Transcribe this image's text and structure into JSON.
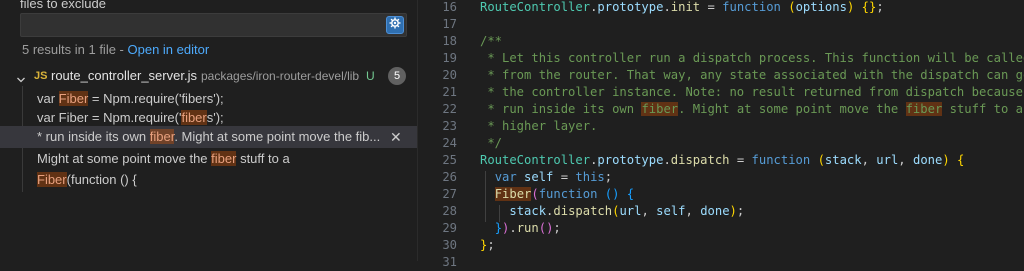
{
  "search": {
    "exclude_label": "files to exclude",
    "exclude_value": "",
    "results_summary": "5 results in 1 file - ",
    "open_in_editor": "Open in editor",
    "file": {
      "type_badge": "JS",
      "name": "route_controller_server.js",
      "path": "packages/iron-router-devel/lib",
      "git_status": "U",
      "match_count": "5"
    },
    "matches": [
      {
        "pre": "var ",
        "hit": "Fiber",
        "post": " = Npm.require('fibers');"
      },
      {
        "pre": "var Fiber = Npm.require('",
        "hit": "fiber",
        "post": "s');"
      },
      {
        "pre": "* run inside its own ",
        "hit": "fiber",
        "post": ". Might at some point move the fib..."
      },
      {
        "pre": "Might at some point move the ",
        "hit": "fiber",
        "post": " stuff to a"
      },
      {
        "pre": "",
        "hit": "Fiber",
        "post": "(function () {"
      }
    ],
    "dismiss_glyph": "✕"
  },
  "editor": {
    "lines": [
      {
        "n": "16",
        "parts": [
          {
            "t": "RouteController",
            "c": "cls"
          },
          {
            "t": ".",
            "c": "punc"
          },
          {
            "t": "prototype",
            "c": "vr"
          },
          {
            "t": ".",
            "c": "punc"
          },
          {
            "t": "init",
            "c": "fn"
          },
          {
            "t": " = ",
            "c": "punc"
          },
          {
            "t": "function",
            "c": "kw"
          },
          {
            "t": " ",
            "c": "punc"
          },
          {
            "t": "(",
            "c": "brk"
          },
          {
            "t": "options",
            "c": "vr"
          },
          {
            "t": ")",
            "c": "brk"
          },
          {
            "t": " ",
            "c": "punc"
          },
          {
            "t": "{}",
            "c": "brk"
          },
          {
            "t": ";",
            "c": "punc"
          }
        ]
      },
      {
        "n": "17",
        "parts": []
      },
      {
        "n": "18",
        "parts": [
          {
            "t": "/**",
            "c": "cmt"
          }
        ]
      },
      {
        "n": "19",
        "parts": [
          {
            "t": " * Let this controller run a dispatch process. This function will be called",
            "c": "cmt"
          }
        ]
      },
      {
        "n": "20",
        "parts": [
          {
            "t": " * from the router. That way, any state associated with the dispatch can go on",
            "c": "cmt"
          }
        ]
      },
      {
        "n": "21",
        "parts": [
          {
            "t": " * the controller instance. Note: no result returned from dispatch because its",
            "c": "cmt"
          }
        ]
      },
      {
        "n": "22",
        "parts": [
          {
            "t": " * run inside its own ",
            "c": "cmt"
          },
          {
            "t": "fiber",
            "c": "cmt hlc"
          },
          {
            "t": ". Might at some point move the ",
            "c": "cmt"
          },
          {
            "t": "fiber",
            "c": "cmt hlc"
          },
          {
            "t": " stuff to a",
            "c": "cmt"
          }
        ]
      },
      {
        "n": "23",
        "parts": [
          {
            "t": " * higher layer.",
            "c": "cmt"
          }
        ]
      },
      {
        "n": "24",
        "parts": [
          {
            "t": " */",
            "c": "cmt"
          }
        ]
      },
      {
        "n": "25",
        "parts": [
          {
            "t": "RouteController",
            "c": "cls"
          },
          {
            "t": ".",
            "c": "punc"
          },
          {
            "t": "prototype",
            "c": "vr"
          },
          {
            "t": ".",
            "c": "punc"
          },
          {
            "t": "dispatch",
            "c": "fn"
          },
          {
            "t": " = ",
            "c": "punc"
          },
          {
            "t": "function",
            "c": "kw"
          },
          {
            "t": " ",
            "c": "punc"
          },
          {
            "t": "(",
            "c": "brk"
          },
          {
            "t": "stack",
            "c": "vr"
          },
          {
            "t": ", ",
            "c": "punc"
          },
          {
            "t": "url",
            "c": "vr"
          },
          {
            "t": ", ",
            "c": "punc"
          },
          {
            "t": "done",
            "c": "vr"
          },
          {
            "t": ")",
            "c": "brk"
          },
          {
            "t": " ",
            "c": "punc"
          },
          {
            "t": "{",
            "c": "brk"
          }
        ]
      },
      {
        "n": "26",
        "parts": [
          {
            "t": "  ",
            "c": "punc"
          },
          {
            "t": "var",
            "c": "kw"
          },
          {
            "t": " ",
            "c": "punc"
          },
          {
            "t": "self",
            "c": "vr"
          },
          {
            "t": " = ",
            "c": "punc"
          },
          {
            "t": "this",
            "c": "kw"
          },
          {
            "t": ";",
            "c": "punc"
          }
        ]
      },
      {
        "n": "27",
        "parts": [
          {
            "t": "  ",
            "c": "punc"
          },
          {
            "t": "Fiber",
            "c": "fn hlc"
          },
          {
            "t": "(",
            "c": "brk2"
          },
          {
            "t": "function",
            "c": "kw"
          },
          {
            "t": " ",
            "c": "punc"
          },
          {
            "t": "()",
            "c": "brk3"
          },
          {
            "t": " ",
            "c": "punc"
          },
          {
            "t": "{",
            "c": "brk3"
          }
        ]
      },
      {
        "n": "28",
        "parts": [
          {
            "t": "    ",
            "c": "punc"
          },
          {
            "t": "stack",
            "c": "vr"
          },
          {
            "t": ".",
            "c": "punc"
          },
          {
            "t": "dispatch",
            "c": "fn"
          },
          {
            "t": "(",
            "c": "brk"
          },
          {
            "t": "url",
            "c": "vr"
          },
          {
            "t": ", ",
            "c": "punc"
          },
          {
            "t": "self",
            "c": "vr"
          },
          {
            "t": ", ",
            "c": "punc"
          },
          {
            "t": "done",
            "c": "vr"
          },
          {
            "t": ")",
            "c": "brk"
          },
          {
            "t": ";",
            "c": "punc"
          }
        ]
      },
      {
        "n": "29",
        "parts": [
          {
            "t": "  ",
            "c": "punc"
          },
          {
            "t": "}",
            "c": "brk3"
          },
          {
            "t": ")",
            "c": "brk2"
          },
          {
            "t": ".",
            "c": "punc"
          },
          {
            "t": "run",
            "c": "fn"
          },
          {
            "t": "()",
            "c": "brk2"
          },
          {
            "t": ";",
            "c": "punc"
          }
        ]
      },
      {
        "n": "30",
        "parts": [
          {
            "t": "}",
            "c": "brk"
          },
          {
            "t": ";",
            "c": "punc"
          }
        ]
      },
      {
        "n": "31",
        "parts": []
      }
    ]
  },
  "colors": {
    "accent": "#4daafc",
    "match_highlight": "#ea5c00",
    "js_badge": "#d9b33a",
    "git_untracked": "#73c991"
  },
  "icons": {
    "exclude_settings": "gear-icon",
    "expand": "chevron-down-icon",
    "dismiss": "close-icon"
  }
}
